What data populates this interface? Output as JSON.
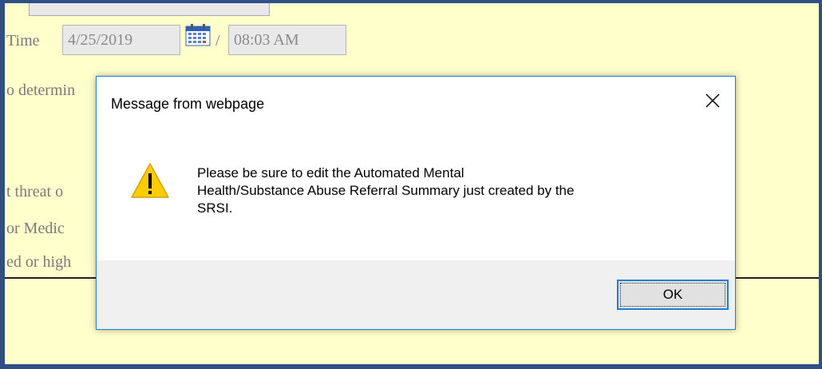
{
  "background": {
    "time_label": "Time",
    "date_value": "4/25/2019",
    "separator": "/",
    "time_value": "08:03 AM",
    "partial_lines": [
      "o determin",
      "t threat o",
      " or Medic",
      "ed or high"
    ]
  },
  "dialog": {
    "title": "Message from webpage",
    "message_lines": [
      "Please be sure to edit the Automated Mental",
      "Health/Substance Abuse Referral Summary just created by the",
      "SRSI."
    ],
    "ok_label": "OK"
  },
  "colors": {
    "page_background": "#ffffcc",
    "frame_border": "#2f4f86",
    "dialog_accent": "#1e7fd8",
    "warning_yellow": "#ffcc00"
  }
}
